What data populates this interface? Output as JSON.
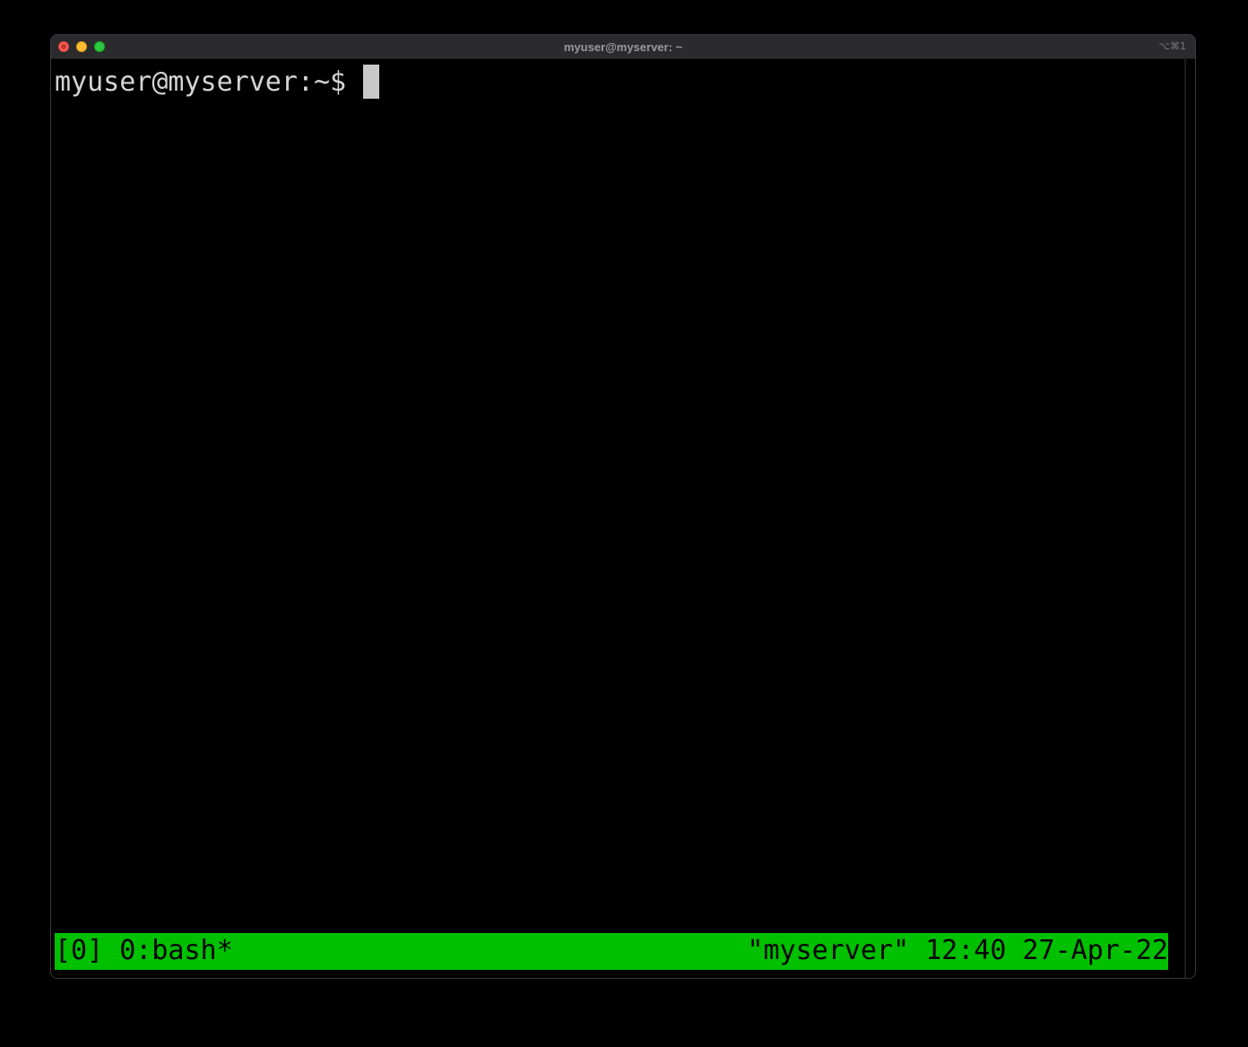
{
  "window": {
    "title": "myuser@myserver: ~",
    "shortcut": "⌥⌘1"
  },
  "terminal": {
    "prompt": "myuser@myserver:~$"
  },
  "tmux_status": {
    "left": "[0] 0:bash*",
    "right": "\"myserver\" 12:40 27-Apr-22",
    "color": "#00c000"
  },
  "colors": {
    "close": "#ff5f57",
    "minimize": "#febc2e",
    "maximize": "#28c840"
  }
}
